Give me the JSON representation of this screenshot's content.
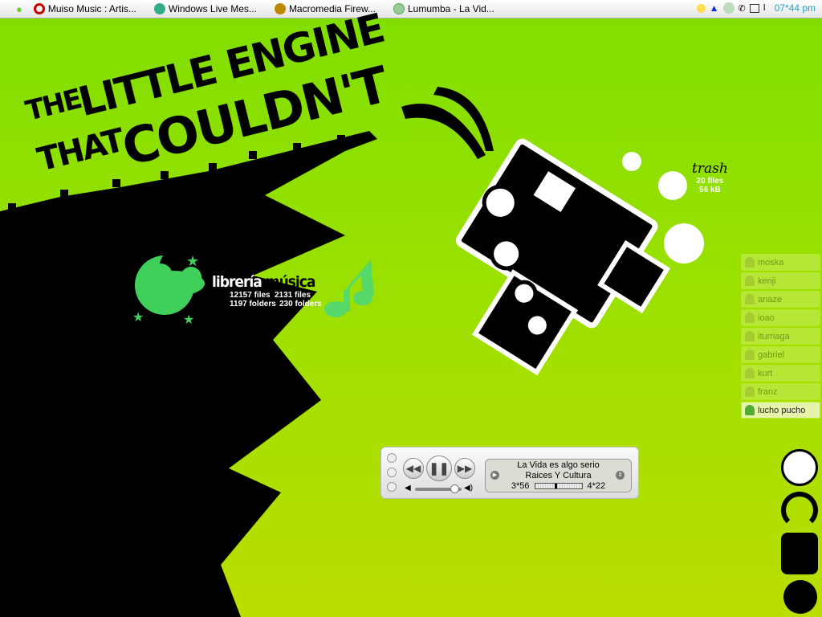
{
  "menubar": {
    "items": [
      {
        "label": "Muiso Music : Artis...",
        "icon": "opera-icon",
        "color": "#c00"
      },
      {
        "label": "Windows Live Mes...",
        "icon": "messenger-icon",
        "color": "#3a8"
      },
      {
        "label": "Macromedia Firew...",
        "icon": "fireworks-icon",
        "color": "#b80"
      },
      {
        "label": "Lumumba - La Vid...",
        "icon": "itunes-icon",
        "color": "#5a5"
      }
    ],
    "clock": "07*44 pm"
  },
  "poster": {
    "line1": "THE LITTLE ENGINE",
    "line1a": "THE",
    "line1b": "LITTLE ENGINE",
    "line2a": "THAT",
    "line2b": "COULDN'T"
  },
  "library": {
    "title_a": "librería",
    "title_b": "música",
    "files_a": "12157 files",
    "files_b": "2131 files",
    "folders_a": "1197 folders",
    "folders_b": "230 folders"
  },
  "trash": {
    "label": "trash",
    "files": "20 files",
    "size": "56 kB"
  },
  "buddies": [
    "moska",
    "kenji",
    "anaze",
    "ioao",
    "iturriaga",
    "gabriel",
    "kurt",
    "franz",
    "lucho pucho"
  ],
  "player": {
    "track": "La Vida es algo serio",
    "album": "Raices Y Cultura",
    "elapsed": "3*56",
    "remaining": "4*22",
    "progress": 0.48,
    "volume": 0.85
  },
  "colors": {
    "bg": "#8ee000",
    "accent_green": "#3fcf5a"
  }
}
